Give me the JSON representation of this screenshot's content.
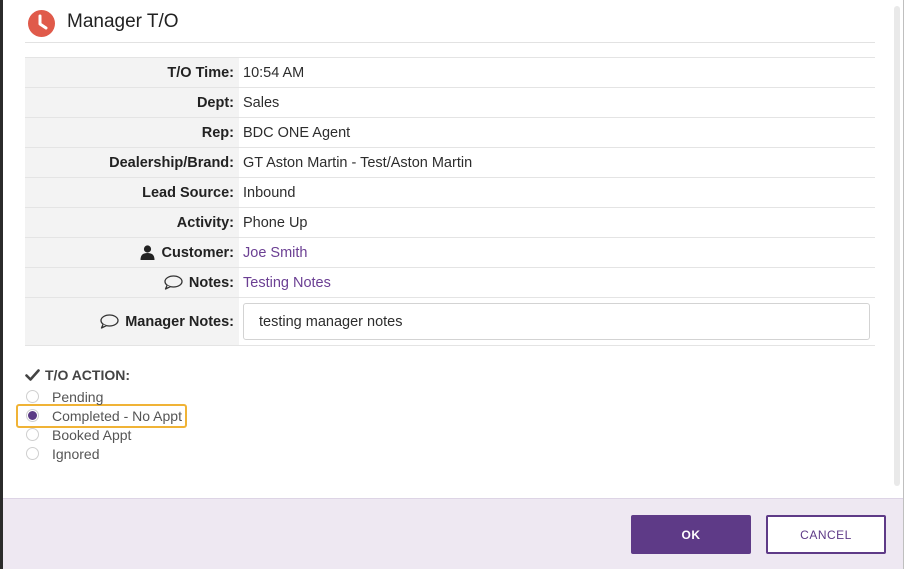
{
  "header": {
    "title": "Manager T/O",
    "icon": "clock-icon",
    "icon_color": "#e05a4a"
  },
  "details": [
    {
      "label": "T/O Time:",
      "value": "10:54 AM"
    },
    {
      "label": "Dept:",
      "value": "Sales"
    },
    {
      "label": "Rep:",
      "value": "BDC ONE Agent"
    },
    {
      "label": "Dealership/Brand:",
      "value": "GT Aston Martin - Test/Aston Martin"
    },
    {
      "label": "Lead Source:",
      "value": "Inbound"
    },
    {
      "label": "Activity:",
      "value": "Phone Up"
    },
    {
      "label": "Customer:",
      "value": "Joe Smith",
      "icon": "user-icon"
    },
    {
      "label": "Notes:",
      "value": "Testing Notes",
      "icon": "comment-icon"
    },
    {
      "label": "Manager Notes:",
      "value": "testing manager notes",
      "icon": "comment-icon"
    }
  ],
  "action": {
    "title": "T/O ACTION:",
    "options": [
      {
        "label": "Pending",
        "selected": false
      },
      {
        "label": "Completed - No Appt",
        "selected": true
      },
      {
        "label": "Booked Appt",
        "selected": false
      },
      {
        "label": "Ignored",
        "selected": false
      }
    ]
  },
  "footer": {
    "ok_label": "OK",
    "cancel_label": "CANCEL"
  },
  "colors": {
    "accent": "#5e3a87",
    "link": "#6b3f93",
    "highlight": "#f0b336",
    "footer_bg": "#eee8f2"
  }
}
